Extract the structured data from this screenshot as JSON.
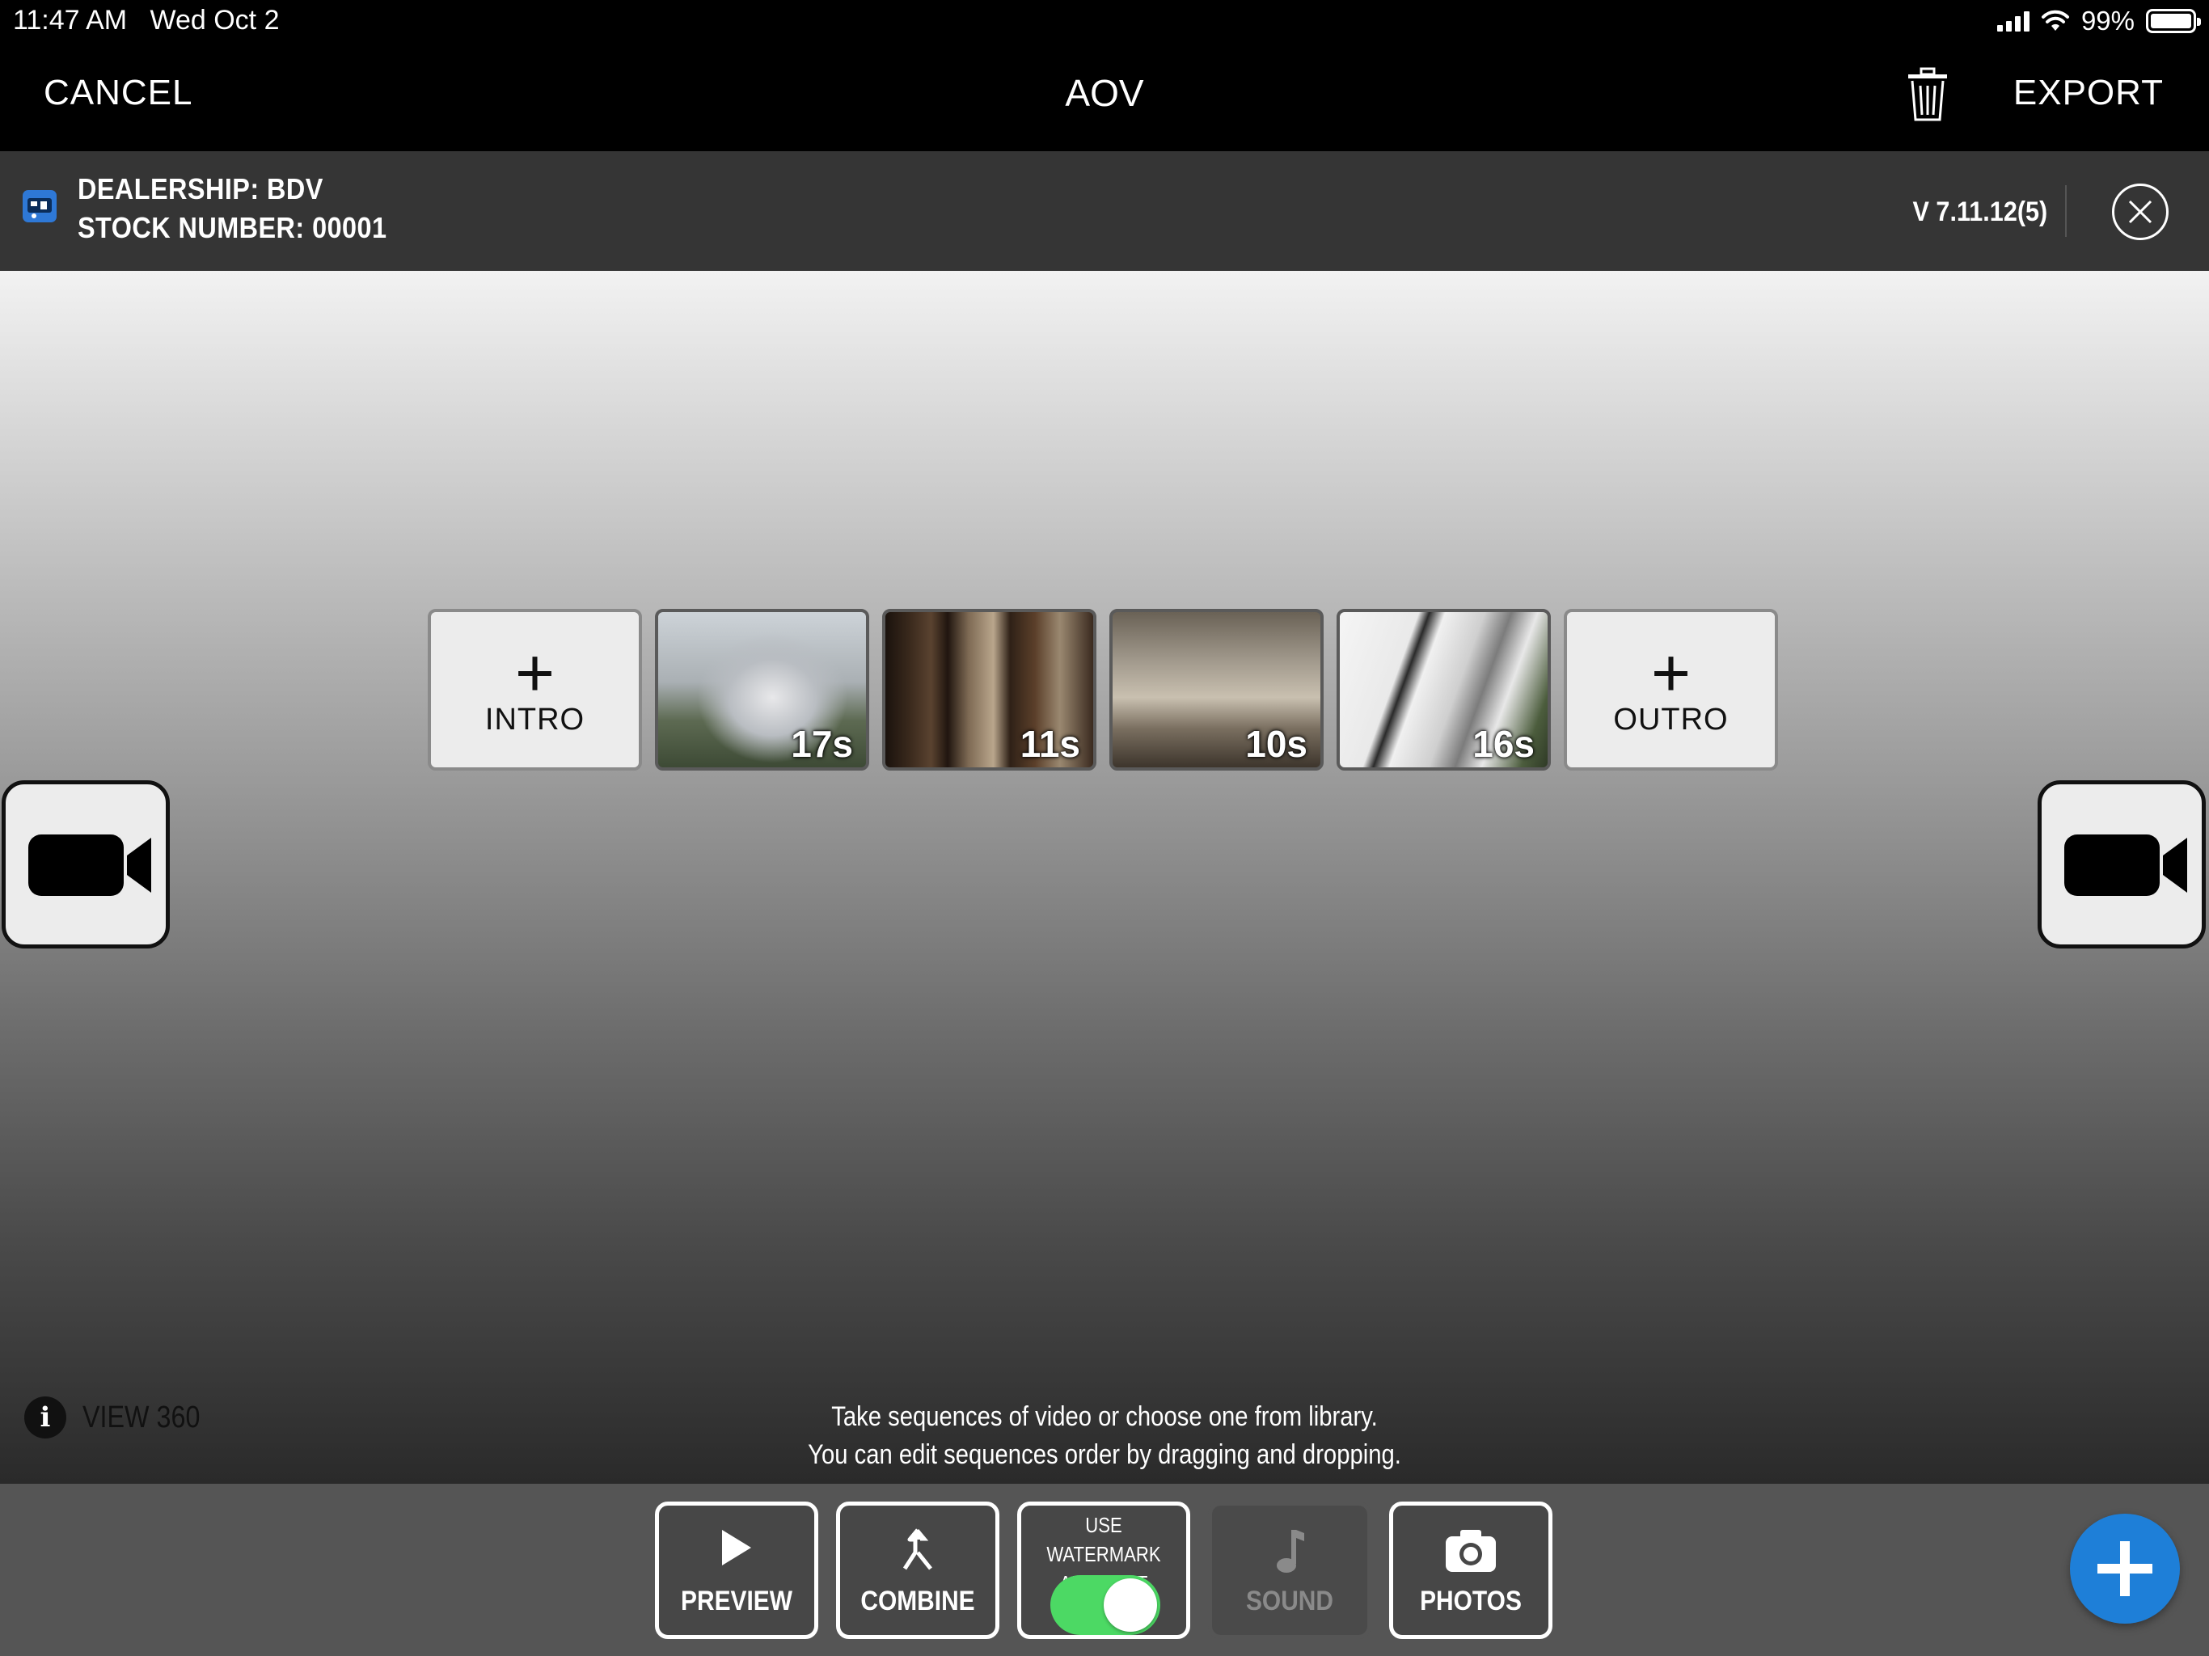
{
  "status": {
    "time": "11:47 AM",
    "date": "Wed Oct 2",
    "battery": "99%"
  },
  "nav": {
    "cancel": "CANCEL",
    "title": "AOV",
    "export": "EXPORT"
  },
  "info": {
    "dealership": "DEALERSHIP: BDV",
    "stock_number": "STOCK NUMBER: 00001",
    "version": "V 7.11.12(5)"
  },
  "timeline": {
    "intro_label": "INTRO",
    "outro_label": "OUTRO",
    "clips": [
      {
        "duration": "17s"
      },
      {
        "duration": "11s"
      },
      {
        "duration": "10s"
      },
      {
        "duration": "16s"
      }
    ]
  },
  "view360": {
    "label": "VIEW 360"
  },
  "hints": {
    "line1": "Take sequences of video or choose one from library.",
    "line2": "You can edit sequences order by dragging and dropping."
  },
  "toolbar": {
    "preview": "PREVIEW",
    "combine": "COMBINE",
    "watermark_line1": "USE WATERMARK",
    "watermark_line2": "AND TEXT SCROLL",
    "watermark_enabled": true,
    "sound": "SOUND",
    "photos": "PHOTOS"
  },
  "colors": {
    "toggle_on": "#4cd964",
    "fab": "#1e7fd8",
    "info_icon": "#2e78d6"
  },
  "icons": {
    "trash": "trash-icon",
    "close": "close-circle-icon",
    "camera": "video-camera-icon",
    "play": "play-icon",
    "combine": "merge-arrow-icon",
    "sound": "music-note-icon",
    "photos": "photo-camera-icon",
    "add": "plus-icon",
    "info": "info-icon"
  }
}
